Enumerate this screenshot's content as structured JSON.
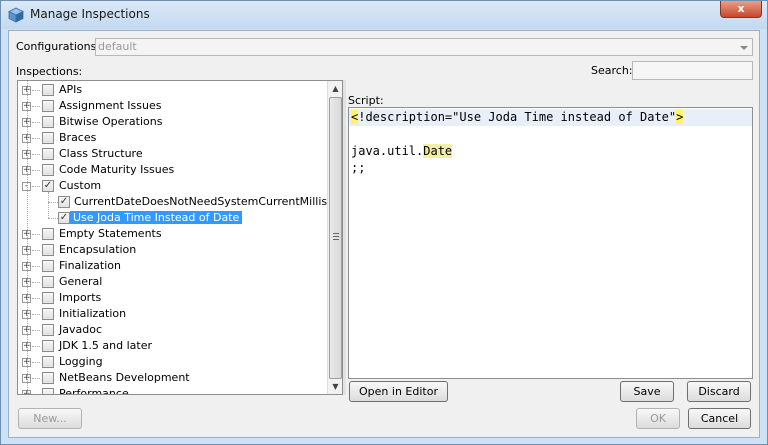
{
  "window": {
    "title": "Manage Inspections",
    "close_glyph": "x"
  },
  "configurations": {
    "label": "Configurations:",
    "value": "default"
  },
  "inspections": {
    "label": "Inspections:"
  },
  "search": {
    "label": "Search:",
    "value": ""
  },
  "script": {
    "label": "Script:"
  },
  "tree": {
    "items": [
      {
        "label": "APIs",
        "expand": "+",
        "checked": false,
        "level": 0
      },
      {
        "label": "Assignment Issues",
        "expand": "+",
        "checked": false,
        "level": 0
      },
      {
        "label": "Bitwise Operations",
        "expand": "+",
        "checked": false,
        "level": 0
      },
      {
        "label": "Braces",
        "expand": "+",
        "checked": false,
        "level": 0
      },
      {
        "label": "Class Structure",
        "expand": "+",
        "checked": false,
        "level": 0
      },
      {
        "label": "Code Maturity Issues",
        "expand": "+",
        "checked": false,
        "level": 0
      },
      {
        "label": "Custom",
        "expand": "-",
        "checked": true,
        "level": 0
      },
      {
        "label": "CurrentDateDoesNotNeedSystemCurrentMillis",
        "expand": "",
        "checked": true,
        "level": 1
      },
      {
        "label": "Use Joda Time Instead of Date",
        "expand": "",
        "checked": true,
        "level": 1,
        "selected": true
      },
      {
        "label": "Empty Statements",
        "expand": "+",
        "checked": false,
        "level": 0
      },
      {
        "label": "Encapsulation",
        "expand": "+",
        "checked": false,
        "level": 0
      },
      {
        "label": "Finalization",
        "expand": "+",
        "checked": false,
        "level": 0
      },
      {
        "label": "General",
        "expand": "+",
        "checked": false,
        "level": 0
      },
      {
        "label": "Imports",
        "expand": "+",
        "checked": false,
        "level": 0
      },
      {
        "label": "Initialization",
        "expand": "+",
        "checked": false,
        "level": 0
      },
      {
        "label": "Javadoc",
        "expand": "+",
        "checked": false,
        "level": 0
      },
      {
        "label": "JDK 1.5 and later",
        "expand": "+",
        "checked": false,
        "level": 0
      },
      {
        "label": "Logging",
        "expand": "+",
        "checked": false,
        "level": 0
      },
      {
        "label": "NetBeans Development",
        "expand": "+",
        "checked": false,
        "level": 0
      },
      {
        "label": "Performance",
        "expand": "+",
        "checked": false,
        "level": 0
      }
    ]
  },
  "editor": {
    "line1_open": "<",
    "line1_body": "!description=\"Use Joda Time instead of Date\"",
    "line1_close": ">",
    "line3_prefix": "java.util.",
    "line3_hl": "Date",
    "line4": ";;"
  },
  "buttons": {
    "open_in_editor": "Open in Editor",
    "save": "Save",
    "discard": "Discard",
    "new": "New...",
    "ok": "OK",
    "cancel": "Cancel"
  },
  "colors": {
    "selection": "#3399ff",
    "bracket_match": "#fff36b",
    "token_highlight": "#f3eea0"
  }
}
